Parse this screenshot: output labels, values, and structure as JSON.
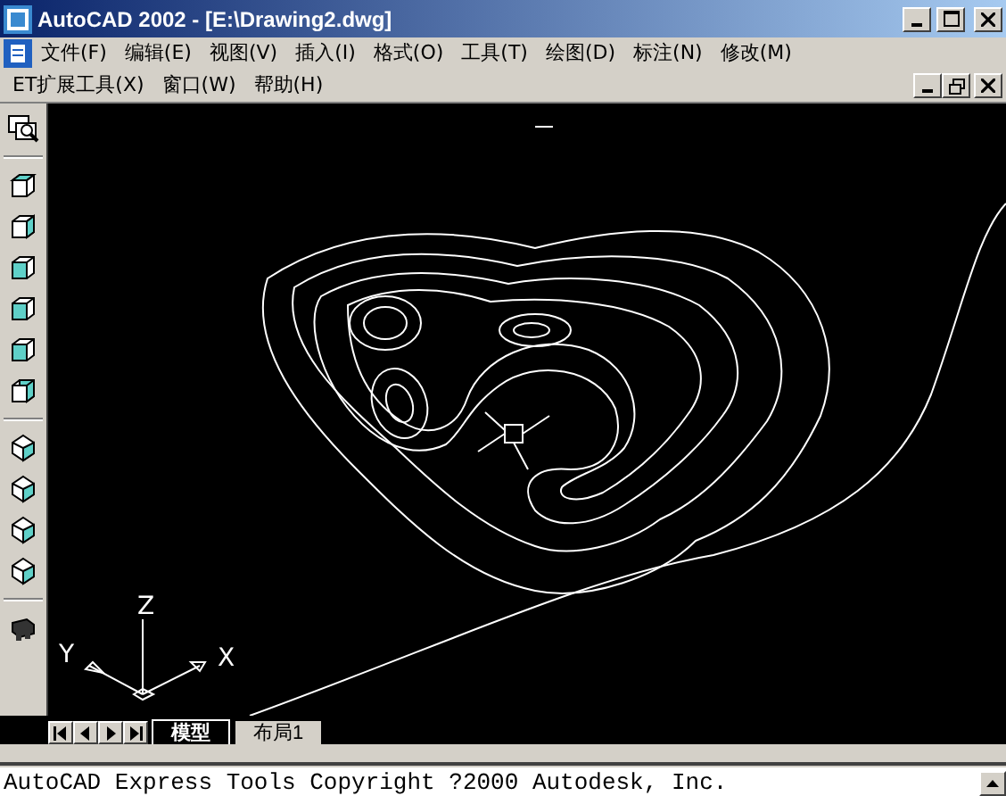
{
  "window": {
    "title": "AutoCAD 2002 - [E:\\Drawing2.dwg]"
  },
  "menu_bar": {
    "items": [
      {
        "label": "文件(F)"
      },
      {
        "label": "编辑(E)"
      },
      {
        "label": "视图(V)"
      },
      {
        "label": "插入(I)"
      },
      {
        "label": "格式(O)"
      },
      {
        "label": "工具(T)"
      },
      {
        "label": "绘图(D)"
      },
      {
        "label": "标注(N)"
      },
      {
        "label": "修改(M)"
      }
    ]
  },
  "menu_bar_2": {
    "items": [
      {
        "label": "ET扩展工具(X)"
      },
      {
        "label": "窗口(W)"
      },
      {
        "label": "帮助(H)"
      }
    ]
  },
  "ucs": {
    "x": "X",
    "y": "Y",
    "z": "Z"
  },
  "layout_tabs": [
    {
      "label": "模型",
      "selected": true
    },
    {
      "label": "布局1",
      "selected": false
    }
  ],
  "command_line": {
    "text": "AutoCAD Express Tools Copyright ?2000 Autodesk, Inc."
  }
}
